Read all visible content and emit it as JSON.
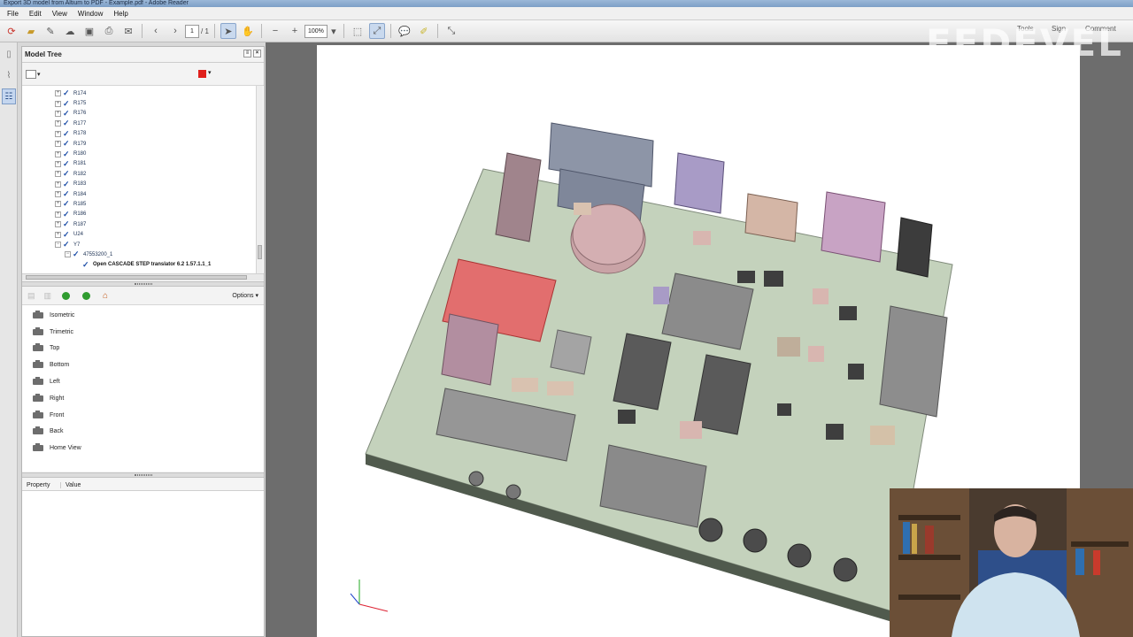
{
  "window": {
    "title": "Export 3D model from Altium to PDF - Example.pdf - Adobe Reader"
  },
  "menu": [
    "File",
    "Edit",
    "View",
    "Window",
    "Help"
  ],
  "toolbar": {
    "page_current": "1",
    "page_total": "/ 1",
    "zoom": "100%",
    "right_items": [
      "Tools",
      "Sign",
      "Comment"
    ]
  },
  "model_tree": {
    "title": "Model Tree",
    "items": [
      {
        "label": "R174",
        "expanded": false
      },
      {
        "label": "R175",
        "expanded": false
      },
      {
        "label": "R176",
        "expanded": false
      },
      {
        "label": "R177",
        "expanded": false
      },
      {
        "label": "R178",
        "expanded": false
      },
      {
        "label": "R179",
        "expanded": false
      },
      {
        "label": "R180",
        "expanded": false
      },
      {
        "label": "R181",
        "expanded": false
      },
      {
        "label": "R182",
        "expanded": false
      },
      {
        "label": "R183",
        "expanded": false
      },
      {
        "label": "R184",
        "expanded": false
      },
      {
        "label": "R185",
        "expanded": false
      },
      {
        "label": "R186",
        "expanded": false
      },
      {
        "label": "R187",
        "expanded": false
      },
      {
        "label": "U24",
        "expanded": false
      },
      {
        "label": "Y7",
        "expanded": true
      },
      {
        "label": "47553200_1",
        "expanded": true,
        "indent": 1
      },
      {
        "label": "Open CASCADE STEP translator 6.2 1.57.1.1_1",
        "expanded": false,
        "indent": 2,
        "bold": true
      }
    ]
  },
  "views": {
    "options_label": "Options",
    "items": [
      "Isometric",
      "Trimetric",
      "Top",
      "Bottom",
      "Left",
      "Right",
      "Front",
      "Back",
      "Home View"
    ]
  },
  "properties": {
    "col_property": "Property",
    "col_value": "Value"
  },
  "watermark": "FEDEVEL",
  "colors": {
    "accent_red": "#e0201c",
    "doc_bg": "#6d6d6d",
    "pcb": "#c4d2bc"
  }
}
